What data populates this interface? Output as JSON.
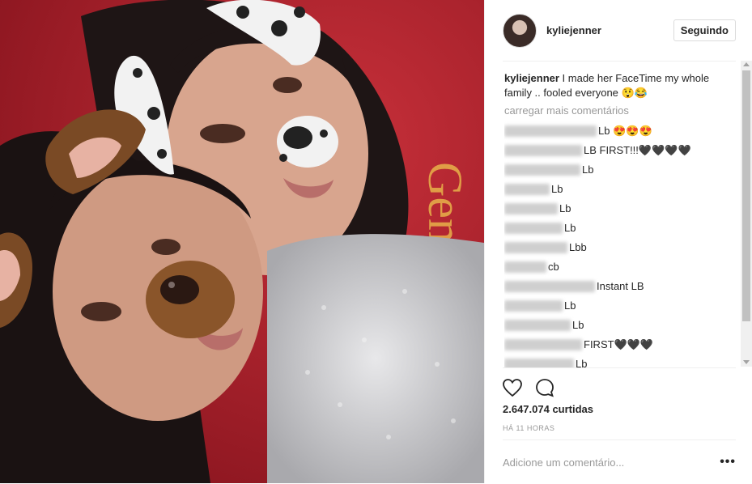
{
  "post": {
    "username": "kyliejenner",
    "follow_label": "Seguindo",
    "caption_user": "kyliejenner",
    "caption_text": " I made her FaceTime my whole family .. fooled everyone 😲😂",
    "load_more": "carregar mais comentários",
    "comments": [
      {
        "text": "Lb 😍😍😍"
      },
      {
        "text": "LB FIRST!!!🖤🖤🖤🖤"
      },
      {
        "text": "Lb"
      },
      {
        "text": "Lb"
      },
      {
        "text": "Lb"
      },
      {
        "text": "Lb"
      },
      {
        "text": "Lbb"
      },
      {
        "text": "cb"
      },
      {
        "text": "Instant LB"
      },
      {
        "text": "Lb"
      },
      {
        "text": "Lb"
      },
      {
        "text": "FIRST🖤🖤🖤"
      },
      {
        "text": "Lb"
      }
    ],
    "likes": "2.647.074 curtidas",
    "time": "HÁ 11 HORAS",
    "add_comment_placeholder": "Adicione um comentário...",
    "more_label": "•••"
  },
  "icons": {
    "like": "heart-icon",
    "comment": "comment-icon"
  }
}
